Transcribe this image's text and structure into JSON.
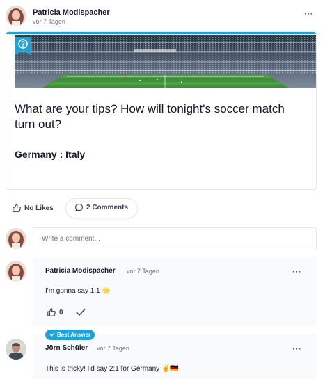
{
  "post": {
    "author": "Patricia Modispacher",
    "time": "vor 7 Tagen",
    "question": "What are your tips? How will tonight's soccer match turn out?",
    "match": "Germany : Italy",
    "menu_icon": "more-horizontal-icon",
    "badge_icon": "question-circle-icon"
  },
  "actions": {
    "likes_label": "No Likes",
    "comments_label": "2 Comments"
  },
  "comment_input": {
    "placeholder": "Write a comment..."
  },
  "comments": [
    {
      "author": "Patricia Modispacher",
      "time": "vor 7 Tagen",
      "text": "I'm gonna say 1:1 🌟",
      "likes": "0"
    },
    {
      "badge": "Best Answer",
      "author": "Jörn Schüler",
      "time": "vor 7 Tagen",
      "text": "This is tricky! I'd say 2:1 for Germany ✌🇩🇪"
    }
  ],
  "colors": {
    "accent": "#1fa3d6",
    "pitch": "#3f8f3a"
  }
}
